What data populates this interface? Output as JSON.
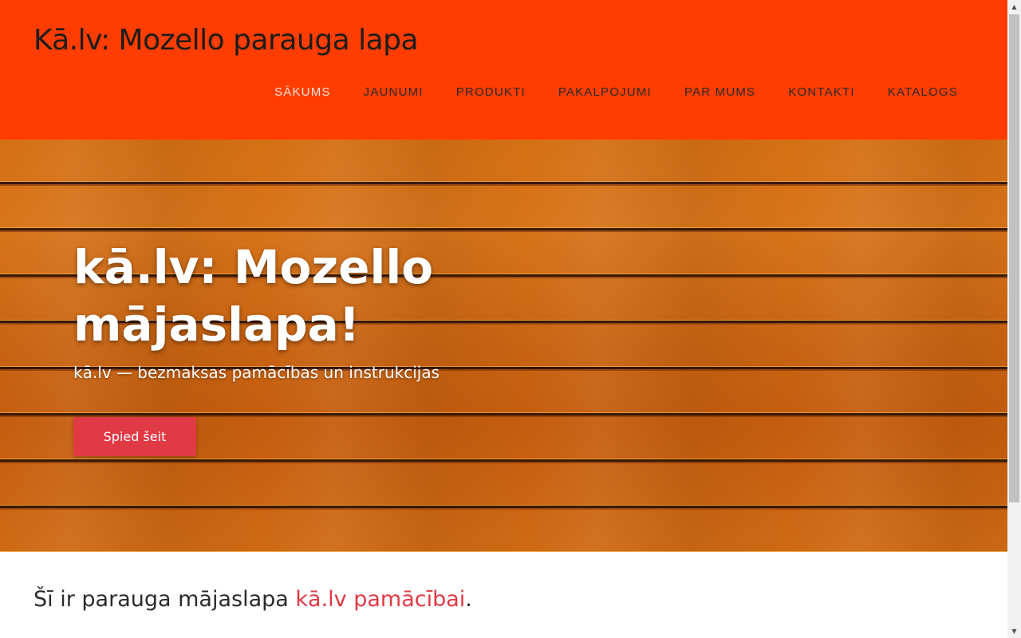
{
  "header": {
    "site_title": "Kā.lv: Mozello parauga lapa",
    "background_color": "#ff3d00"
  },
  "nav": {
    "items": [
      {
        "label": "SĀKUMS",
        "active": true
      },
      {
        "label": "JAUNUMI"
      },
      {
        "label": "PRODUKTI"
      },
      {
        "label": "PAKALPOJUMI"
      },
      {
        "label": "PAR MUMS"
      },
      {
        "label": "KONTAKTI"
      },
      {
        "label": "KATALOGS"
      }
    ]
  },
  "hero": {
    "title": "kā.lv: Mozello mājaslapa!",
    "subtitle": "kā.lv — bezmaksas pamācības un instrukcijas",
    "button_label": "Spied šeit",
    "button_color": "#e03a45",
    "background": "wood-planks-texture"
  },
  "content": {
    "intro_text": "Šī ir parauga mājaslapa ",
    "intro_link": "kā.lv pamācībai",
    "intro_end": ".",
    "link_color": "#e03a45"
  },
  "scrollbar": {
    "up_icon": "scroll-up-arrow-icon",
    "down_icon": "scroll-down-arrow-icon"
  }
}
